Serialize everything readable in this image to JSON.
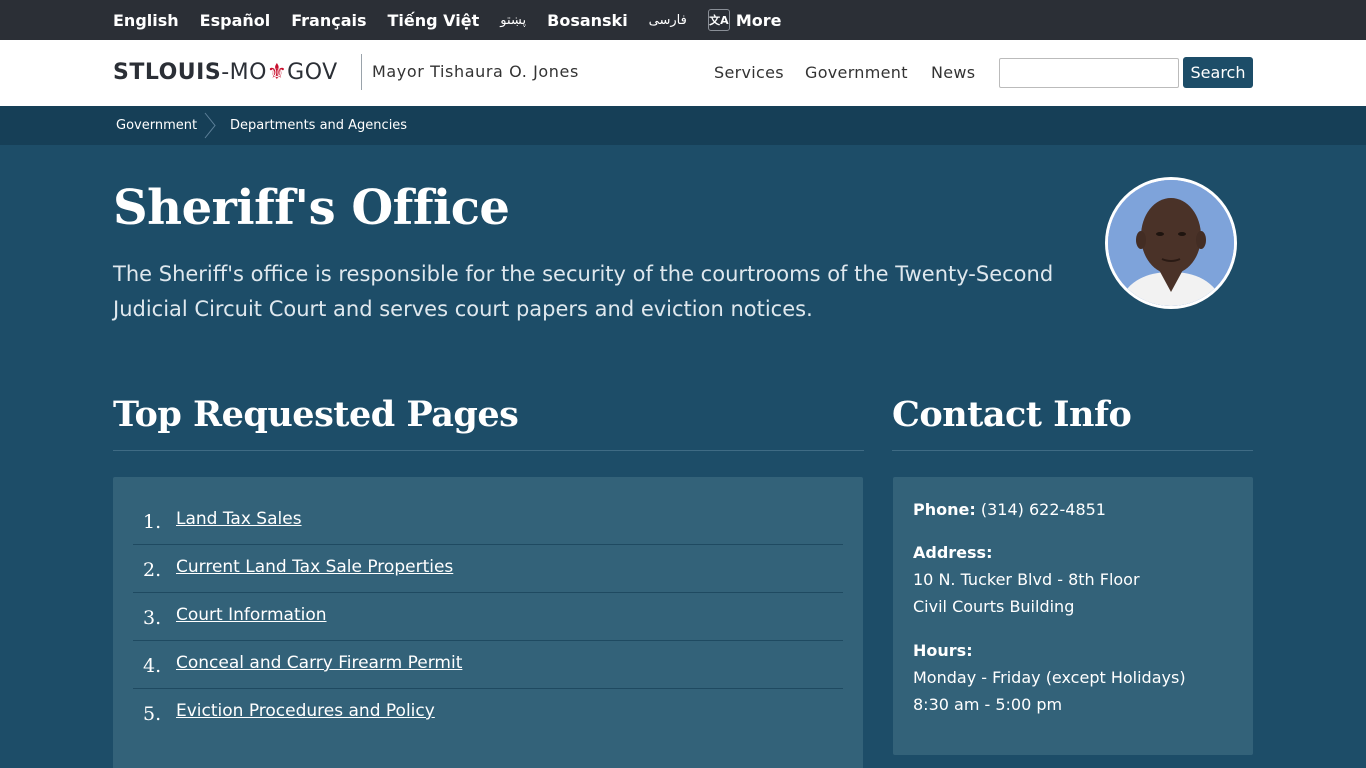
{
  "languages": [
    "English",
    "Español",
    "Français",
    "Tiếng Việt",
    "پښتو",
    "Bosanski",
    "فارسی"
  ],
  "more_label": "More",
  "logo": {
    "stlouis": "STLOUIS",
    "mo": "-MO",
    "gov": "GOV",
    "fleur": "⚜"
  },
  "mayor": "Mayor Tishaura O. Jones",
  "nav": {
    "services": "Services",
    "government": "Government",
    "news": "News"
  },
  "search": {
    "button": "Search",
    "placeholder": ""
  },
  "breadcrumb": [
    "Government",
    "Departments and Agencies"
  ],
  "hero": {
    "title": "Sheriff's Office",
    "description": "The Sheriff's office is responsible for the security of the courtrooms of the Twenty-Second Judicial Circuit Court and serves court papers and eviction notices."
  },
  "top_pages": {
    "heading": "Top Requested Pages",
    "items": [
      {
        "num": "1.",
        "label": "Land Tax Sales"
      },
      {
        "num": "2.",
        "label": "Current Land Tax Sale Properties"
      },
      {
        "num": "3.",
        "label": "Court Information"
      },
      {
        "num": "4.",
        "label": "Conceal and Carry Firearm Permit"
      },
      {
        "num": "5.",
        "label": "Eviction Procedures and Policy"
      }
    ]
  },
  "contact": {
    "heading": "Contact Info",
    "phone_label": "Phone:",
    "phone": "(314) 622-4851",
    "address_label": "Address:",
    "address_line1": "10 N. Tucker Blvd - 8th Floor",
    "address_line2": "Civil Courts Building",
    "hours_label": "Hours:",
    "hours_line1": "Monday - Friday (except Holidays)",
    "hours_line2": "8:30 am - 5:00 pm"
  },
  "colors": {
    "page_bg": "#1d4d68",
    "topbar": "#2b2f36",
    "breadcrumb": "#163f57",
    "panel": "#336279",
    "fleur": "#c8102e"
  }
}
